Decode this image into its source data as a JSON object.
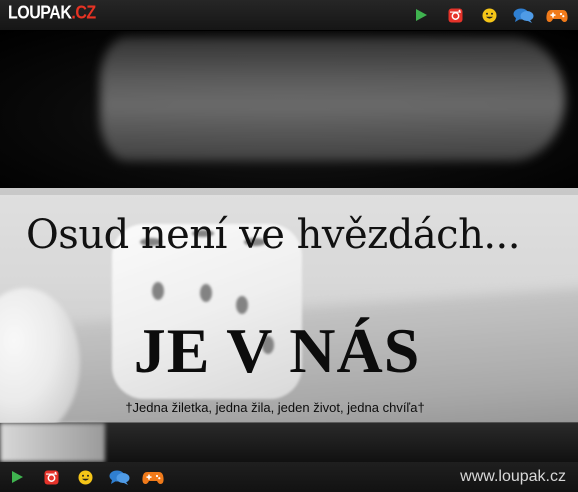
{
  "header": {
    "logo_main": "LOUPAK",
    "logo_tld": ".CZ",
    "icons": [
      "play-icon",
      "instagram-icon",
      "smiley-icon",
      "chat-icon",
      "gamepad-icon"
    ]
  },
  "meme": {
    "line1": "Osud není ve hvězdách...",
    "line2": "JE V NÁS",
    "line3": "†Jedna žiletka, jedna žila, jeden život, jedna chvíľa†"
  },
  "footer": {
    "url": "www.loupak.cz",
    "icons": [
      "play-icon",
      "instagram-icon",
      "smiley-icon",
      "chat-icon",
      "gamepad-icon"
    ]
  },
  "colors": {
    "play": "#3fb34f",
    "instagram": "#e5332a",
    "smiley": "#f5c518",
    "chat": "#2f7fd1",
    "gamepad": "#f07a1a",
    "logo_tld": "#e63324"
  }
}
